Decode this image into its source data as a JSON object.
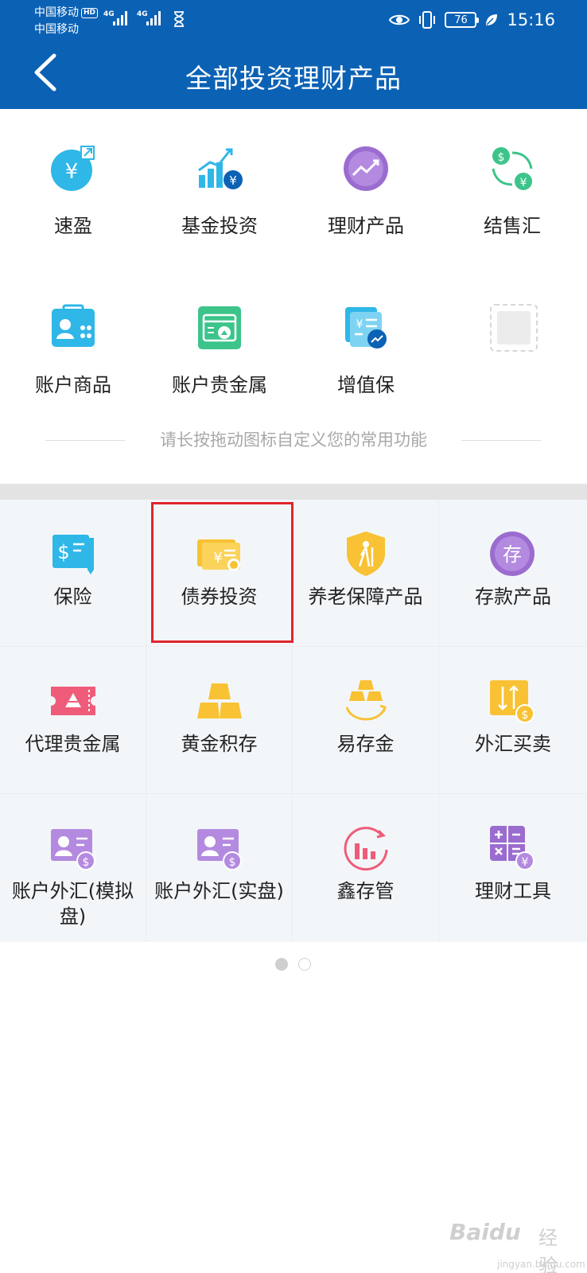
{
  "status_bar": {
    "carrier_1": "中国移动",
    "carrier_1_badge": "HD",
    "carrier_2": "中国移动",
    "signal_1_type": "4G",
    "signal_2_type": "4G",
    "battery": "76",
    "time": "15:16"
  },
  "header": {
    "title": "全部投资理财产品",
    "background": "#0b62b5"
  },
  "favorites": {
    "items": [
      {
        "label": "速盈",
        "icon": "yuan-coin-icon"
      },
      {
        "label": "基金投资",
        "icon": "growth-chart-icon"
      },
      {
        "label": "理财产品",
        "icon": "trend-circle-icon"
      },
      {
        "label": "结售汇",
        "icon": "currency-exchange-icon"
      },
      {
        "label": "账户商品",
        "icon": "account-card-icon"
      },
      {
        "label": "账户贵金属",
        "icon": "account-gold-icon"
      },
      {
        "label": "增值保",
        "icon": "document-growth-icon"
      }
    ],
    "hint": "请长按拖动图标自定义您的常用功能"
  },
  "products": {
    "items": [
      {
        "label": "保险",
        "icon": "insurance-icon"
      },
      {
        "label": "债券投资",
        "icon": "bond-icon"
      },
      {
        "label": "养老保障产品",
        "icon": "pension-shield-icon"
      },
      {
        "label": "存款产品",
        "icon": "deposit-icon"
      },
      {
        "label": "代理贵金属",
        "icon": "precious-metal-ticket-icon"
      },
      {
        "label": "黄金积存",
        "icon": "gold-bars-icon"
      },
      {
        "label": "易存金",
        "icon": "gold-stack-cycle-icon"
      },
      {
        "label": "外汇买卖",
        "icon": "forex-trade-icon"
      },
      {
        "label": "账户外汇(模拟盘)",
        "icon": "account-forex-demo-icon"
      },
      {
        "label": "账户外汇(实盘)",
        "icon": "account-forex-live-icon"
      },
      {
        "label": "鑫存管",
        "icon": "bar-chart-circle-icon"
      },
      {
        "label": "理财工具",
        "icon": "calculator-icon"
      }
    ],
    "highlighted": "债券投资",
    "highlight_color": "#e0242b"
  },
  "pagination": {
    "current": 1,
    "total": 2
  },
  "watermark": {
    "brand": "Baidu",
    "product": "经验",
    "url": "jingyan.baidu.com"
  }
}
